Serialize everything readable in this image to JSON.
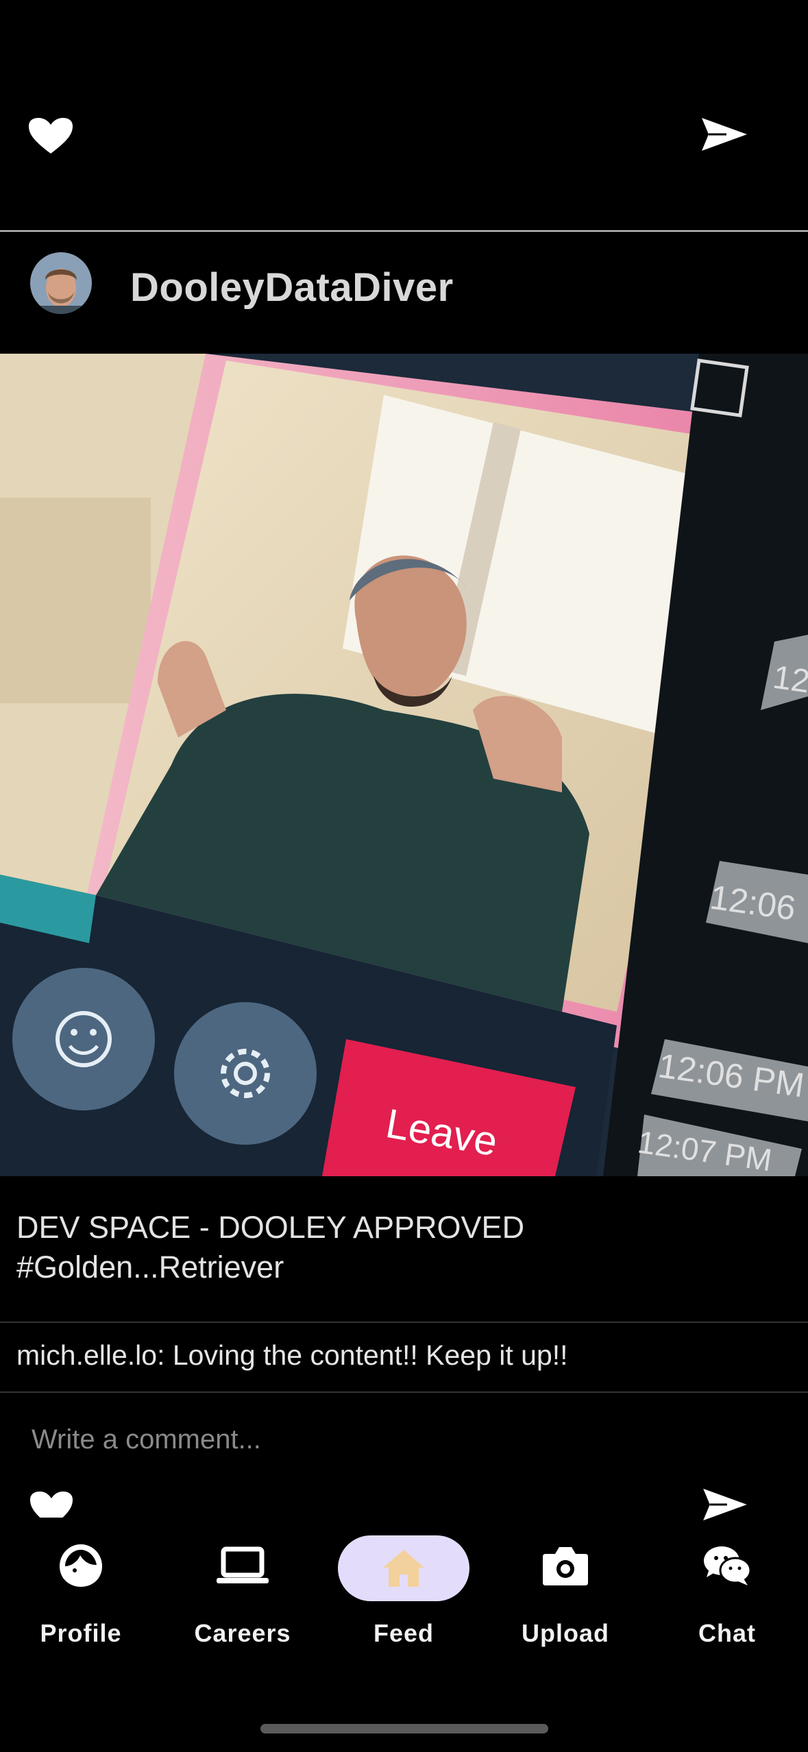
{
  "post": {
    "username": "DooleyDataDiver",
    "caption": "DEV SPACE - DOOLEY APPROVED #Golden...Retriever",
    "photo": {
      "leave_label": "Leave",
      "timestamps": [
        "12",
        "12:06",
        "12:06 PM",
        "12:07 PM"
      ]
    },
    "comments": [
      {
        "text": "mich.elle.lo: Loving the content!! Keep it up!!"
      }
    ]
  },
  "comment_input": {
    "placeholder": "Write a comment..."
  },
  "nav": {
    "items": [
      {
        "label": "Profile",
        "icon": "profile-icon"
      },
      {
        "label": "Careers",
        "icon": "laptop-icon"
      },
      {
        "label": "Feed",
        "icon": "home-icon",
        "active": true
      },
      {
        "label": "Upload",
        "icon": "camera-icon"
      },
      {
        "label": "Chat",
        "icon": "chat-icon"
      }
    ]
  },
  "colors": {
    "background": "#000000",
    "nav_active_pill": "#e4dcfb",
    "nav_active_icon": "#f3d19c",
    "leave_button": "#e21f4f"
  }
}
